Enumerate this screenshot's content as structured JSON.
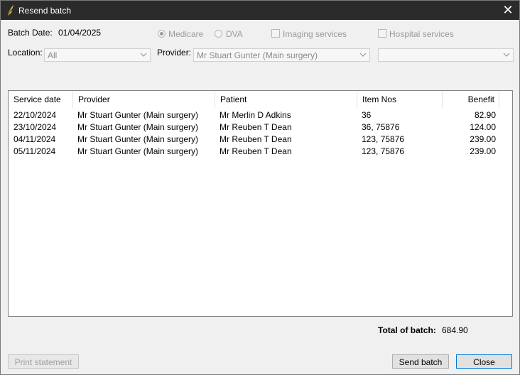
{
  "window": {
    "title": "Resend batch",
    "icon": "app-feather-icon",
    "close_glyph": "✕"
  },
  "filters": {
    "batch_date_label": "Batch Date:",
    "batch_date_value": "01/04/2025",
    "medicare_label": "Medicare",
    "dva_label": "DVA",
    "imaging_label": "Imaging services",
    "hospital_label": "Hospital services",
    "location_label": "Location:",
    "location_value": "All",
    "provider_label": "Provider:",
    "provider_value": "Mr Stuart Gunter (Main surgery)",
    "extra_value": ""
  },
  "table": {
    "headers": {
      "service_date": "Service date",
      "provider": "Provider",
      "patient": "Patient",
      "item_nos": "Item Nos",
      "benefit": "Benefit"
    },
    "rows": [
      {
        "service_date": "22/10/2024",
        "provider": "Mr Stuart Gunter (Main surgery)",
        "patient": "Mr Merlin D Adkins",
        "item_nos": "36",
        "benefit": "82.90"
      },
      {
        "service_date": "23/10/2024",
        "provider": "Mr Stuart Gunter (Main surgery)",
        "patient": "Mr Reuben T Dean",
        "item_nos": "36, 75876",
        "benefit": "124.00"
      },
      {
        "service_date": "04/11/2024",
        "provider": "Mr Stuart Gunter (Main surgery)",
        "patient": "Mr Reuben T Dean",
        "item_nos": "123, 75876",
        "benefit": "239.00"
      },
      {
        "service_date": "05/11/2024",
        "provider": "Mr Stuart Gunter (Main surgery)",
        "patient": "Mr Reuben T Dean",
        "item_nos": "123, 75876",
        "benefit": "239.00"
      }
    ]
  },
  "total": {
    "label": "Total of batch:",
    "value": "684.90"
  },
  "buttons": {
    "print": "Print statement",
    "send": "Send batch",
    "close": "Close"
  },
  "colors": {
    "titlebar": "#2b2b2b",
    "focus_border": "#0078d7"
  }
}
